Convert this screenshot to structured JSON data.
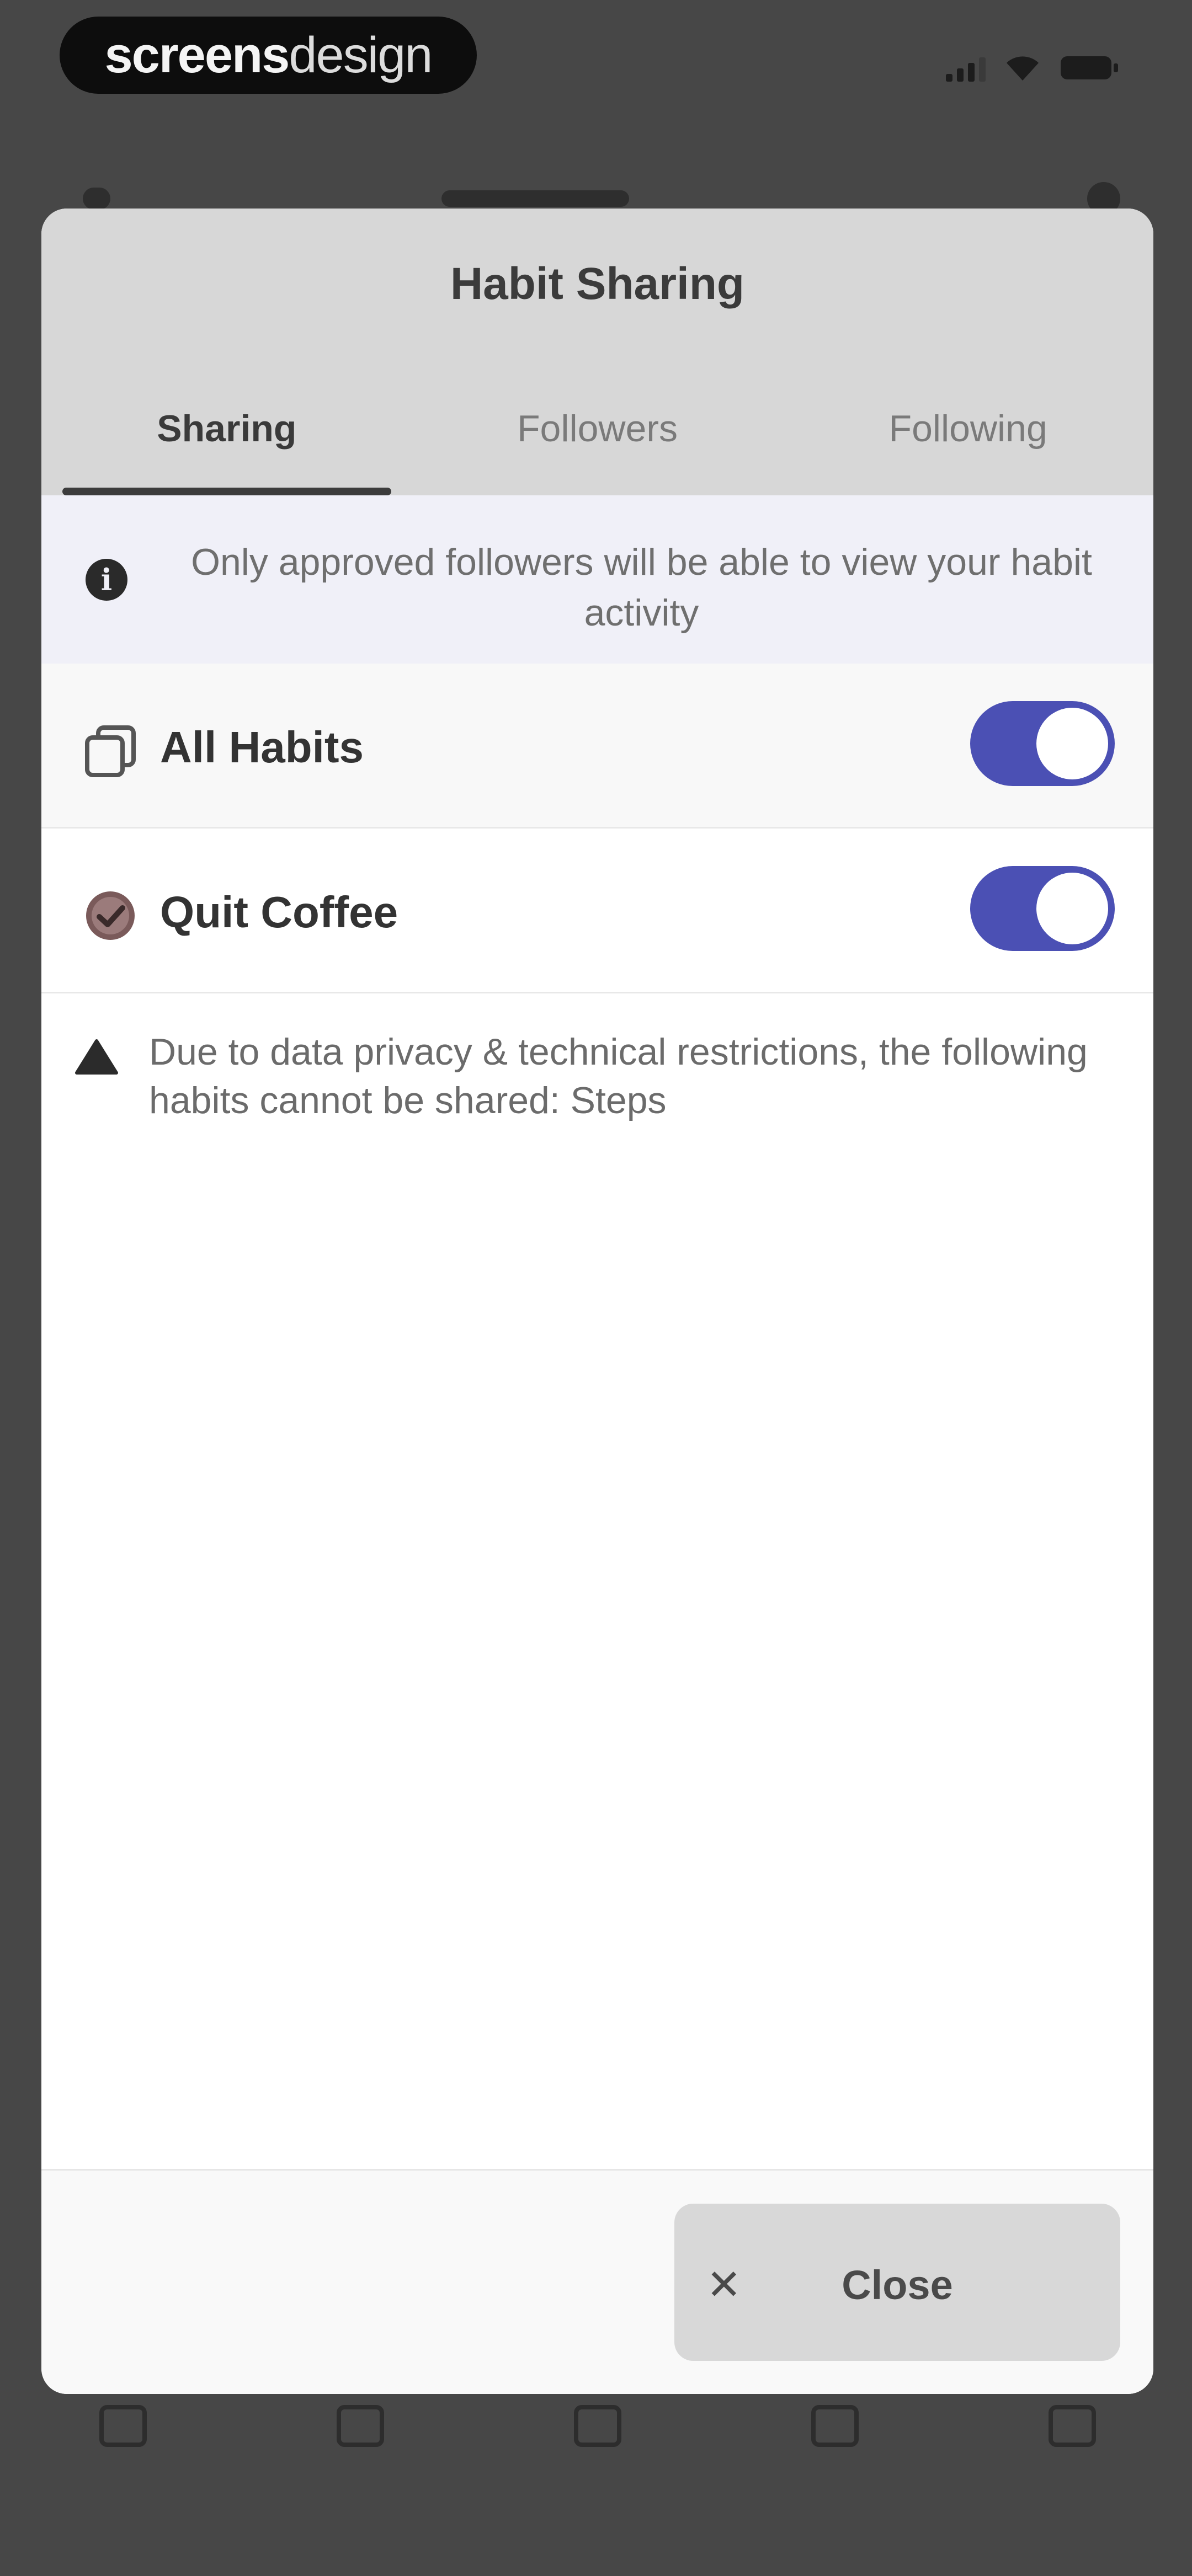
{
  "status_bar": {
    "brand_bold": "screens",
    "brand_light": "design",
    "icons": [
      "signal-icon",
      "wifi-icon",
      "battery-icon"
    ]
  },
  "modal": {
    "title": "Habit Sharing",
    "tabs": [
      {
        "label": "Sharing",
        "active": true
      },
      {
        "label": "Followers",
        "active": false
      },
      {
        "label": "Following",
        "active": false
      }
    ],
    "info_banner": {
      "icon": "info-icon",
      "text": "Only approved followers will be able to view your habit activity"
    },
    "habits": [
      {
        "icon": "copy-stack-icon",
        "label": "All Habits",
        "enabled": true
      },
      {
        "icon": "coffee-habit-icon",
        "label": "Quit Coffee",
        "enabled": true
      }
    ],
    "warning": {
      "icon": "warning-triangle-icon",
      "text": "Due to data privacy & technical restrictions, the following habits cannot be shared: Steps"
    },
    "close_button": {
      "icon": "close-icon",
      "label": "Close"
    }
  },
  "colors": {
    "accent_toggle": "#4b50b4",
    "overlay": "#474747",
    "header_bg": "#d7d7d7",
    "info_bg": "#f0f0f8"
  }
}
